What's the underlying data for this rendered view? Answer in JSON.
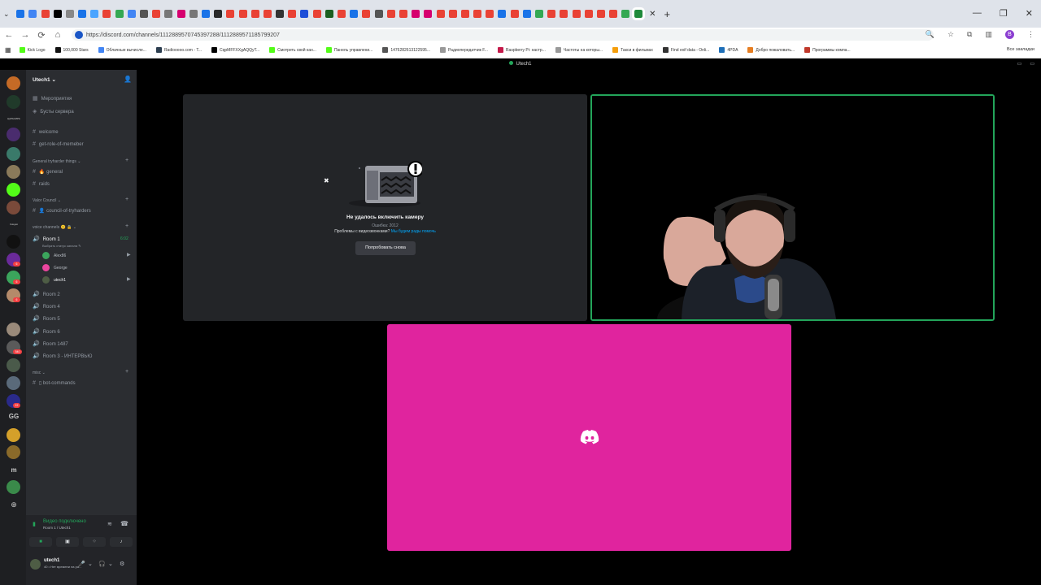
{
  "browser": {
    "url": "https://discord.com/channels/1112889570745397288/1112889571185799207",
    "profile_initial": "B",
    "all_bookmarks_label": "Все закладки",
    "tab_colors": [
      "#1a73e8",
      "#4285f4",
      "#e94235",
      "#000000",
      "#888888",
      "#1a73e8",
      "#4aa4ff",
      "#e94235",
      "#34a853",
      "#4285f4",
      "#555555",
      "#e94235",
      "#777777",
      "#d6006f",
      "#777777",
      "#1a73e8",
      "#2a2a2a",
      "#e94235",
      "#e94235",
      "#e94235",
      "#e94235",
      "#333333",
      "#e94235",
      "#1d4ed8",
      "#e94235",
      "#1b5e20",
      "#e94235",
      "#1a73e8",
      "#e94235",
      "#555555",
      "#e94235",
      "#e94235",
      "#d6006f",
      "#d6006f",
      "#e94235",
      "#e94235",
      "#e94235",
      "#e94235",
      "#e94235",
      "#1a73e8",
      "#e94235",
      "#1a73e8",
      "#34a853",
      "#e94235",
      "#e94235",
      "#e94235",
      "#e94235",
      "#e94235",
      "#e94235",
      "#34a853",
      "#1f8a3b"
    ],
    "bookmarks": [
      {
        "label": "Kick Logo",
        "color": "#53fc18"
      },
      {
        "label": "100,000 Stars",
        "color": "#111111"
      },
      {
        "label": "Облачные вычисле...",
        "color": "#4285f4"
      },
      {
        "label": "Radiooooo.com - T...",
        "color": "#2c3e50"
      },
      {
        "label": "CqpMFFXXgAQQyT...",
        "color": "#000000"
      },
      {
        "label": "Смотреть свой кан...",
        "color": "#53fc18"
      },
      {
        "label": "Панель управлени...",
        "color": "#53fc18"
      },
      {
        "label": "1476282613122595...",
        "color": "#555555"
      },
      {
        "label": "Радиопередатчик F...",
        "color": "#999999"
      },
      {
        "label": "Raspberry Pi: настр...",
        "color": "#c51a4a"
      },
      {
        "label": "Частоты на которы...",
        "color": "#999999"
      },
      {
        "label": "Такси в фильмах",
        "color": "#f59e0b"
      },
      {
        "label": "Find exif data - Onli...",
        "color": "#333333"
      },
      {
        "label": "4PDA",
        "color": "#1e6fb8"
      },
      {
        "label": "Добро пожаловать...",
        "color": "#e67e22"
      },
      {
        "label": "Программы компа...",
        "color": "#c0392b"
      }
    ]
  },
  "discord": {
    "window_title": "Utech1",
    "guild_name": "Utech1",
    "top_items": [
      "Мероприятия",
      "Бусты сервера"
    ],
    "channels_top": [
      "welcome",
      "get-role-of-memeber"
    ],
    "categories": [
      {
        "name": "General tryharder things",
        "channels": [
          "general",
          "raids"
        ]
      },
      {
        "name": "Valor Council",
        "channels": [
          "council-of-tryharders"
        ]
      },
      {
        "name": "voice channels",
        "channels": []
      },
      {
        "name": "misc",
        "channels": [
          "bot-commands"
        ]
      }
    ],
    "general_emoji": "🔥",
    "council_emoji": "👤",
    "voice_emoji": "😊 🔒",
    "bot_emoji": "▯",
    "room1": {
      "name": "Room 1",
      "timer": "6:02",
      "status": "Выбрать статус канала"
    },
    "voice_users": [
      {
        "name": "Alex86",
        "color": "#3ba55c"
      },
      {
        "name": "George",
        "color": "#eb459e"
      },
      {
        "name": "utech1",
        "color": "#4e5d45"
      }
    ],
    "voice_rooms": [
      "Room 2",
      "Room 4",
      "Room 5",
      "Room 6",
      "Room 1487",
      "Room 3 - ИНТЕРВЬЮ"
    ],
    "voice_panel": {
      "status": "Видео подключено",
      "sub": "Room 1 / Utech1"
    },
    "user": {
      "name": "utech1",
      "sub": "40 • Нет времени на ра..."
    },
    "error_tile": {
      "title": "Не удалось включить камеру",
      "code": "Ошибка: 2012",
      "help": "Проблемы с видеозвонками?",
      "help_link": "Мы будем рады помочь",
      "retry": "Попробовать снова"
    },
    "rail_labels": [
      "ЦАРЬКИРЬ",
      "Скидки"
    ],
    "rail_badges": [
      "6",
      "6",
      "6",
      "540",
      "22"
    ],
    "rail_text_servers": [
      "GG",
      "m"
    ]
  }
}
